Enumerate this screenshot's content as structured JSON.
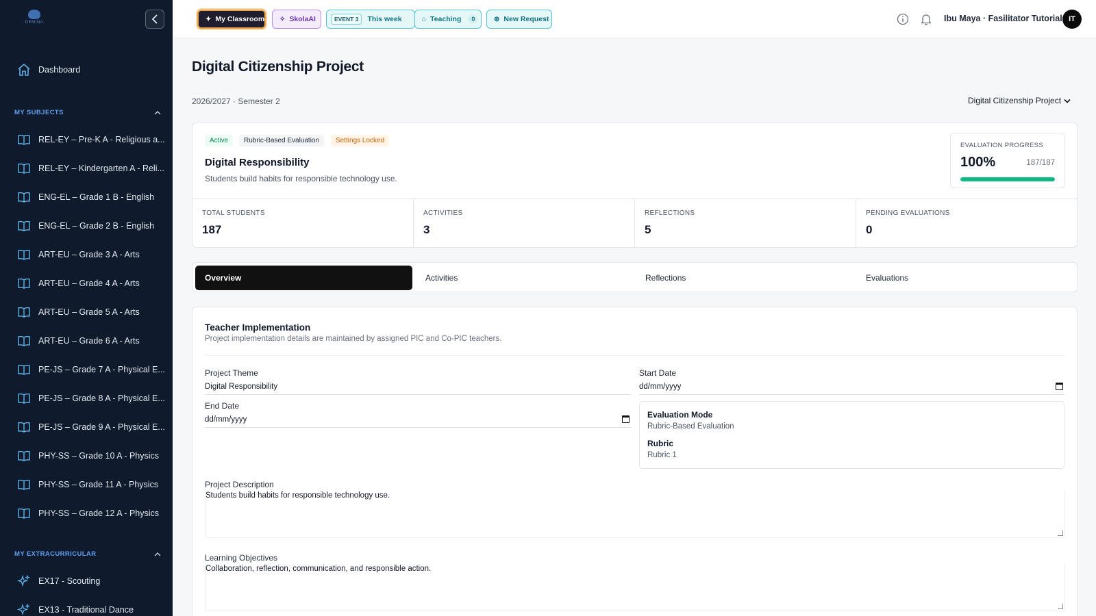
{
  "sidebar": {
    "logo_text": "DEMINA",
    "dashboard_label": "Dashboard",
    "subjects_heading": "MY SUBJECTS",
    "subjects": [
      "REL-EY – Pre-K A - Religious a...",
      "REL-EY – Kindergarten A - Reli...",
      "ENG-EL – Grade 1 B - English",
      "ENG-EL – Grade 2 B - English",
      "ART-EU – Grade 3 A - Arts",
      "ART-EU – Grade 4 A - Arts",
      "ART-EU – Grade 5 A - Arts",
      "ART-EU – Grade 6 A - Arts",
      "PE-JS – Grade 7 A - Physical E...",
      "PE-JS – Grade 8 A - Physical E...",
      "PE-JS – Grade 9 A - Physical E...",
      "PHY-SS – Grade 10 A - Physics",
      "PHY-SS – Grade 11 A - Physics",
      "PHY-SS – Grade 12 A - Physics"
    ],
    "extracurricular_heading": "MY EXTRACURRICULAR",
    "extracurricular": [
      "EX17 - Scouting",
      "EX13 - Traditional Dance"
    ]
  },
  "topbar": {
    "my_classroom": "My Classroom",
    "skolaai": "SkolaAI",
    "event_tag": "EVENT 3",
    "event_label": "This week",
    "teaching": "Teaching",
    "teaching_count": "0",
    "new_request": "New Request",
    "user_name": "Ibu Maya · Fasilitator Tutorial",
    "avatar_initials": "IT"
  },
  "page": {
    "title": "Digital Citizenship Project",
    "term": "2026/2027 · Semester 2",
    "project_select": "Digital Citizenship Project"
  },
  "summary": {
    "tag_status": "Active",
    "tag_mode": "Rubric-Based Evaluation",
    "tag_lock": "Settings Locked",
    "title": "Digital Responsibility",
    "description": "Students build habits for responsible technology use.",
    "progress_label": "EVALUATION PROGRESS",
    "progress_percent": "100%",
    "progress_count": "187/187",
    "progress_fraction": 1.0,
    "stats": [
      {
        "label": "TOTAL STUDENTS",
        "value": "187"
      },
      {
        "label": "ACTIVITIES",
        "value": "3"
      },
      {
        "label": "REFLECTIONS",
        "value": "5"
      },
      {
        "label": "PENDING EVALUATIONS",
        "value": "0"
      }
    ]
  },
  "tabs": [
    "Overview",
    "Activities",
    "Reflections",
    "Evaluations"
  ],
  "form": {
    "title": "Teacher Implementation",
    "subtitle": "Project implementation details are maintained by assigned PIC and Co-PIC teachers.",
    "theme_label": "Project Theme",
    "theme_value": "Digital Responsibility",
    "start_label": "Start Date",
    "start_value": "dd/mm/yyyy",
    "end_label": "End Date",
    "end_value": "dd/mm/yyyy",
    "eval_mode_label": "Evaluation Mode",
    "eval_mode_value": "Rubric-Based Evaluation",
    "rubric_label": "Rubric",
    "rubric_value": "Rubric 1",
    "description_label": "Project Description",
    "description_value": "Students build habits for responsible technology use.",
    "objectives_label": "Learning Objectives",
    "objectives_value": "Collaboration, reflection, communication, and responsible action."
  }
}
